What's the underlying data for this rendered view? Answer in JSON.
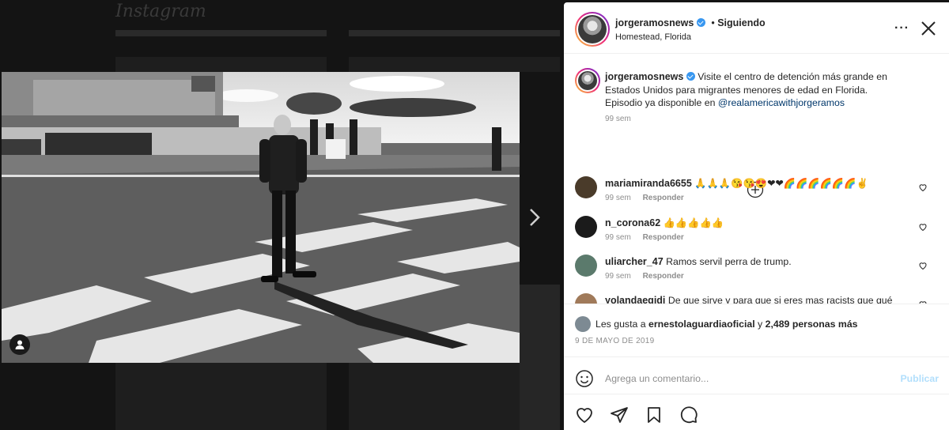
{
  "app": {
    "logo": "Instagram"
  },
  "post": {
    "username": "jorgeramosnews",
    "follow_status": "Siguiendo",
    "separator": "•",
    "location": "Homestead, Florida",
    "more_icon": "more-horizontal-icon",
    "close_icon": "close-icon"
  },
  "caption": {
    "username": "jorgeramosnews",
    "text": "Visite el centro de detención más grande en Estados Unidos para migrantes menores de edad en Florida. Episodio ya disponible en ",
    "mention": "@realamericawithjorgeramos",
    "time": "99 sem"
  },
  "comments": [
    {
      "username": "mariamiranda6655",
      "text": "🙏🙏🙏😘😘😍❤❤🌈🌈🌈🌈🌈🌈✌",
      "time": "99 sem",
      "reply": "Responder",
      "avatar_color": "#4a3b2a"
    },
    {
      "username": "n_corona62",
      "text": "👍👍👍👍👍",
      "time": "99 sem",
      "reply": "Responder",
      "avatar_color": "#1b1b1b"
    },
    {
      "username": "uliarcher_47",
      "text": "Ramos servil perra de trump.",
      "time": "99 sem",
      "reply": "Responder",
      "avatar_color": "#5b7a6c"
    },
    {
      "username": "yolandaegidi",
      "text": "De que sirve y para que si eres mas racists que qué",
      "time": "",
      "reply": "",
      "avatar_color": "#a07a5a"
    }
  ],
  "likes": {
    "prefix": "Les gusta a ",
    "user": "ernestolaguardiaoficial",
    "middle": " y ",
    "count": "2,489 personas más"
  },
  "date": "9 DE MAYO DE 2019",
  "comment_box": {
    "placeholder": "Agrega un comentario...",
    "publish": "Publicar",
    "emoji_icon": "emoji-icon"
  },
  "action_icons": [
    "heart-icon",
    "share-icon",
    "bookmark-icon",
    "comment-icon"
  ],
  "colors": {
    "link": "#00376b",
    "verified": "#3897f0",
    "muted": "#8e8e8e"
  }
}
